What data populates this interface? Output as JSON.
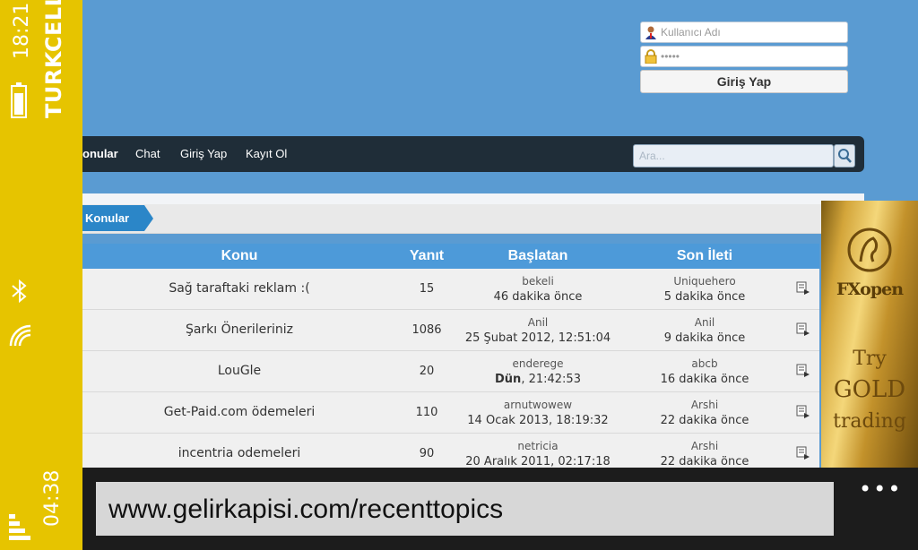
{
  "status": {
    "time_top": "18:21",
    "carrier": "TURKCELL",
    "time_bottom": "04:38",
    "accent_color": "#e6c400"
  },
  "login": {
    "username_placeholder": "Kullanıcı Adı",
    "password_mask": "•••••",
    "button_label": "Giriş Yap"
  },
  "nav": {
    "items": [
      "onular",
      "Chat",
      "Giriş Yap",
      "Kayıt Ol"
    ],
    "search_placeholder": "Ara..."
  },
  "breadcrumb": "Konular",
  "table": {
    "headers": [
      "Konu",
      "Yanıt",
      "Başlatan",
      "Son İleti"
    ],
    "rows": [
      {
        "topic": "Sağ taraftaki reklam :(",
        "replies": "15",
        "starter": "bekeli",
        "starter_date": "46 dakika önce",
        "last": "Uniquehero",
        "last_date": "5 dakika önce"
      },
      {
        "topic": "Şarkı Önerileriniz",
        "replies": "1086",
        "starter": "Anil",
        "starter_date": "25 Şubat 2012, 12:51:04",
        "last": "Anil",
        "last_date": "9 dakika önce"
      },
      {
        "topic": "LouGle",
        "replies": "20",
        "starter": "enderege",
        "starter_date_bold": "Dün",
        "starter_date": ", 21:42:53",
        "last": "abcb",
        "last_date": "16 dakika önce"
      },
      {
        "topic": "Get-Paid.com ödemeleri",
        "replies": "110",
        "starter": "arnutwowew",
        "starter_date": "14 Ocak 2013, 18:19:32",
        "last": "Arshi",
        "last_date": "22 dakika önce"
      },
      {
        "topic": "incentria odemeleri",
        "replies": "90",
        "starter": "netricia",
        "starter_date": "20 Aralık 2011, 02:17:18",
        "last": "Arshi",
        "last_date": "22 dakika önce"
      }
    ]
  },
  "ad": {
    "brand": "FXopen",
    "line1": "Try",
    "line2": "GOLD",
    "line3": "trading"
  },
  "browser": {
    "url": "www.gelirkapisi.com/recenttopics",
    "more": "•••"
  }
}
